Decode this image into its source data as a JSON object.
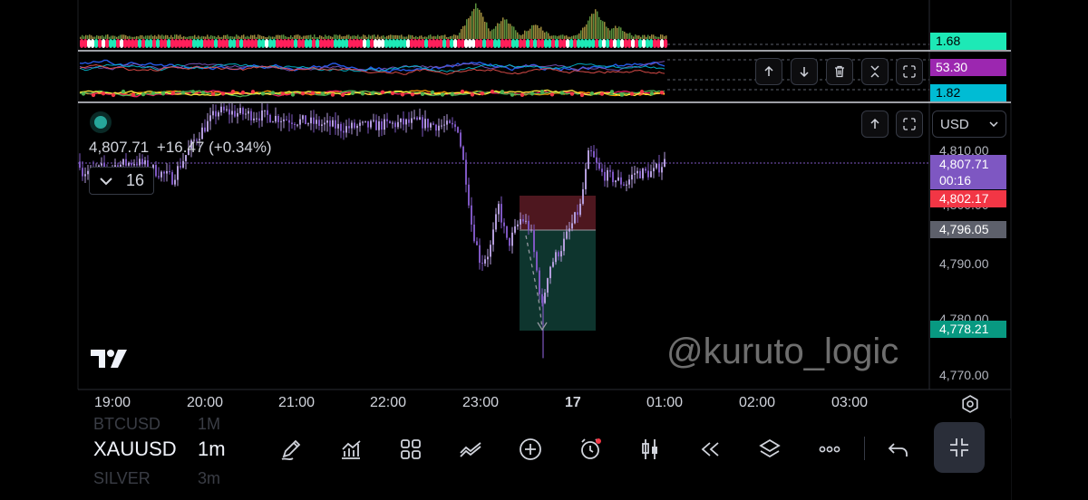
{
  "legend": {
    "price": "4,807.71",
    "change": "+16.47",
    "change_pct": "(+0.34%)",
    "collapse_count": "16"
  },
  "indicator_tags": [
    {
      "value": "1.68",
      "color": "#1de9b6"
    },
    {
      "value": "53.30",
      "color": "#9c27b0"
    },
    {
      "value": "1.82",
      "color": "#00bcd4"
    }
  ],
  "currency_select": "USD",
  "price_axis": [
    "4,810.00",
    "4,800.00",
    "4,790.00",
    "4,780.00",
    "4,770.00"
  ],
  "price_tags": {
    "last_price": "4,807.71",
    "countdown": "00:16",
    "ask": "4,802.17",
    "entry": "4,796.05",
    "target": "4,778.21"
  },
  "time_axis": [
    "19:00",
    "20:00",
    "21:00",
    "22:00",
    "23:00",
    "17",
    "01:00",
    "02:00",
    "03:00"
  ],
  "watermark": "@kuruto_logic",
  "bottom": {
    "symbol": "XAUUSD",
    "interval": "1m",
    "prev_symbol": "BTCUSD",
    "prev_interval": "1M",
    "next_symbol": "SILVER",
    "next_interval": "3m"
  },
  "colors": {
    "candle_up": "#b39ddb",
    "candle_down": "#7e57c2",
    "loss_zone": "#5c1b24",
    "profit_zone": "#0f3b33",
    "last_price": "#7e57c2",
    "ask": "#f23645",
    "entry": "#5d606b",
    "target": "#089981"
  },
  "icons": [
    "arrow-up-icon",
    "arrow-down-icon",
    "trash-icon",
    "collapse-icon",
    "maximize-icon",
    "draw-icon",
    "indicators-icon",
    "layout-icon",
    "compare-icon",
    "add-icon",
    "alert-icon",
    "candles-icon",
    "replay-icon",
    "layers-icon",
    "more-icon",
    "undo-icon",
    "fullscreen-exit-icon",
    "settings-icon"
  ]
}
